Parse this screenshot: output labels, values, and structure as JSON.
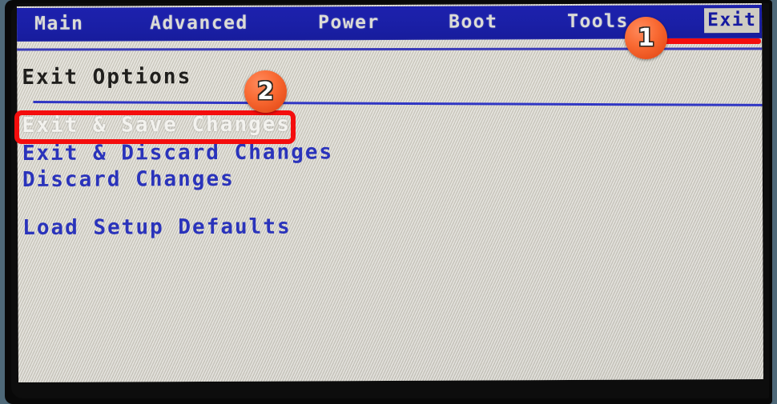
{
  "screen": {
    "background_color": "#d2cfc4",
    "bezel_color": "#080808",
    "surround_color": "#4e6878"
  },
  "menubar": {
    "background_color": "#1a1fa6",
    "text_color": "#dcdcd6",
    "selected_background_color": "#cfccc2",
    "selected_text_color": "#161aa0",
    "items": [
      {
        "label": "Main",
        "selected": false
      },
      {
        "label": "Advanced",
        "selected": false
      },
      {
        "label": "Power",
        "selected": false
      },
      {
        "label": "Boot",
        "selected": false
      },
      {
        "label": "Tools",
        "selected": false
      },
      {
        "label": "Exit",
        "selected": true
      }
    ]
  },
  "main": {
    "heading": "Exit Options",
    "heading_color": "#201f1d",
    "divider_color": "#3036c4",
    "option_color": "#2a33bb",
    "active_option_color": "#f3f2ee",
    "options": [
      {
        "label": "Exit & Save Changes",
        "active": true
      },
      {
        "label": "Exit & Discard Changes",
        "active": false
      },
      {
        "label": "Discard Changes",
        "active": false
      },
      {
        "label": "Load Setup Defaults",
        "active": false
      }
    ]
  },
  "annotations": {
    "accent_color": "#f40d0d",
    "badge_color": "#f96a33",
    "badge_text_color": "#ffffff",
    "badges": [
      {
        "label": "1",
        "target": "Exit"
      },
      {
        "label": "2",
        "target": "Exit & Save Changes"
      }
    ],
    "highlight_box_target": "Exit & Save Changes",
    "underline_target": "Exit"
  }
}
